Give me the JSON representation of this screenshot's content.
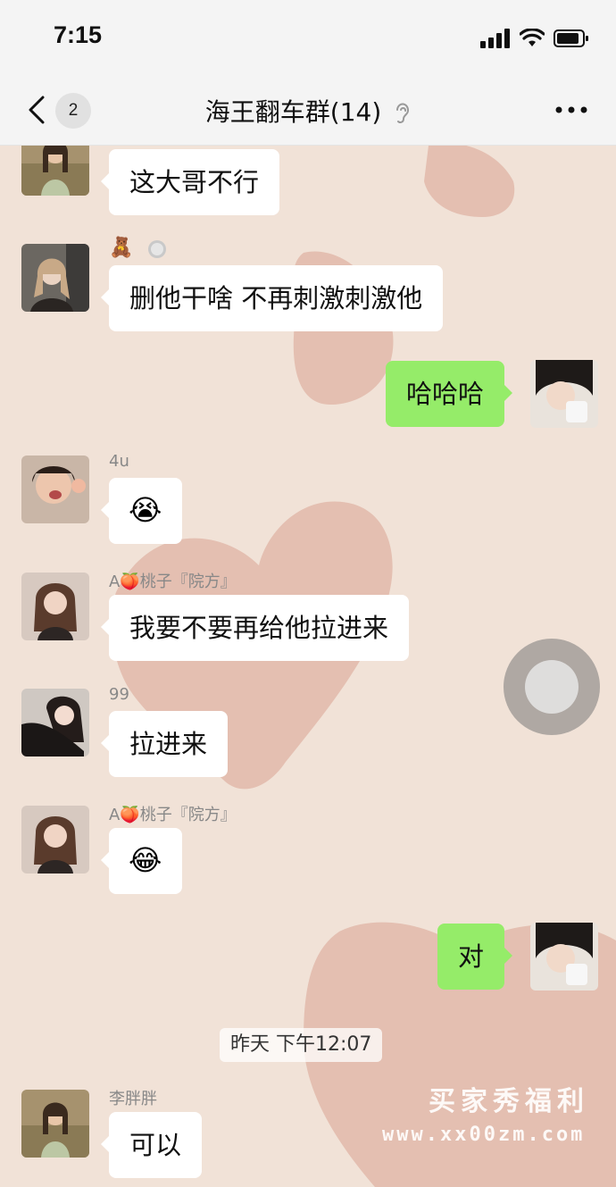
{
  "status_bar": {
    "time": "7:15",
    "icons": [
      "signal-icon",
      "wifi-icon",
      "battery-icon"
    ]
  },
  "nav": {
    "back_icon": "chevron-left-icon",
    "unread_count": "2",
    "title": "海王翻车群(14)",
    "mute_icon": "ear-icon",
    "more_icon": "ellipsis-icon"
  },
  "messages": [
    {
      "side": "left",
      "sender": "",
      "type": "text",
      "text": "这大哥不行"
    },
    {
      "side": "left",
      "sender": "",
      "sender_icons": [
        "teddy-bear-icon",
        "smiley-icon"
      ],
      "type": "text",
      "text": "删他干啥 不再刺激刺激他"
    },
    {
      "side": "right",
      "type": "text",
      "text": "哈哈哈"
    },
    {
      "side": "left",
      "sender": "4u",
      "type": "emoji",
      "emoji": "😭"
    },
    {
      "side": "left",
      "sender": "A🍑桃子『院方』",
      "type": "text",
      "text": "我要不要再给他拉进来"
    },
    {
      "side": "left",
      "sender": "99",
      "type": "text",
      "text": "拉进来"
    },
    {
      "side": "left",
      "sender": "A🍑桃子『院方』",
      "type": "emoji",
      "emoji": "😂"
    },
    {
      "side": "right",
      "type": "text",
      "text": "对"
    },
    {
      "side": "left",
      "sender": "李胖胖",
      "type": "text",
      "text": "可以"
    }
  ],
  "timestamp": "昨天 下午12:07",
  "watermark": {
    "line1": "买家秀福利",
    "line2": "www.xx00zm.com"
  },
  "colors": {
    "background": "#f1e2d7",
    "heart": "#d9a392",
    "my_bubble": "#95ec69",
    "other_bubble": "#ffffff"
  }
}
